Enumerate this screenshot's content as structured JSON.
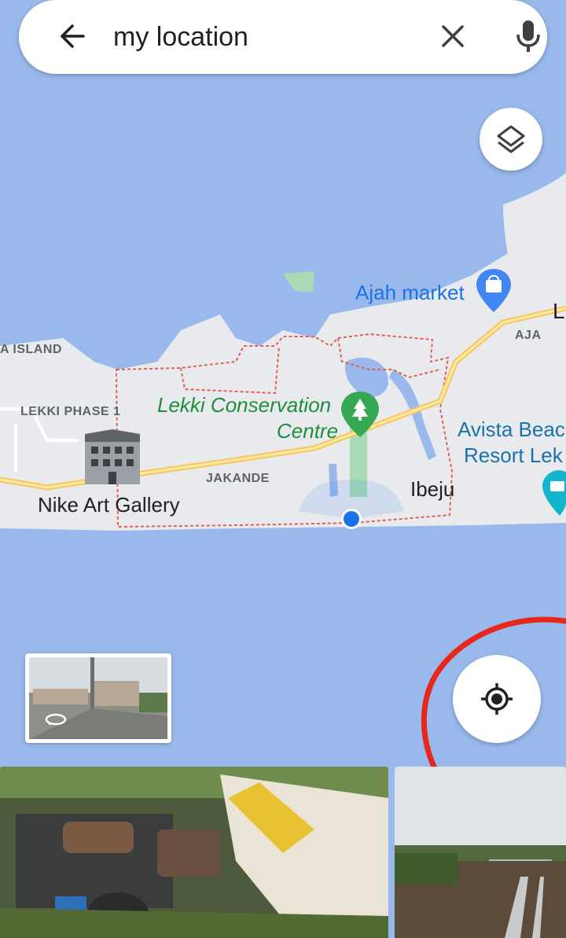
{
  "search": {
    "query": "my location",
    "icons": {
      "back": "arrow-back-icon",
      "clear": "close-icon",
      "mic": "microphone-icon"
    }
  },
  "map": {
    "labels": {
      "ajah_market": "Ajah market",
      "aja": "AJA",
      "aja_letter": "L",
      "island": "A ISLAND",
      "lekki_phase": "LEKKI PHASE 1",
      "lekki_conservation_1": "Lekki Conservation",
      "lekki_conservation_2": "Centre",
      "avista_1": "Avista Beac",
      "avista_2": "Resort Lek",
      "jakande": "JAKANDE",
      "nike": "Nike Art Gallery",
      "ibeju": "Ibeju"
    },
    "colors": {
      "water": "#99b9ec",
      "land": "#e8eaed",
      "road": "#f6c75a",
      "boundary": "#e06055",
      "park": "#a8dab5",
      "location": "#1a73e8"
    }
  },
  "controls": {
    "layers_icon": "layers-icon",
    "locate_icon": "my-location-icon"
  },
  "annotation": {
    "color": "#e8261c"
  },
  "streetview": {
    "icon": "360-rotate-icon"
  }
}
